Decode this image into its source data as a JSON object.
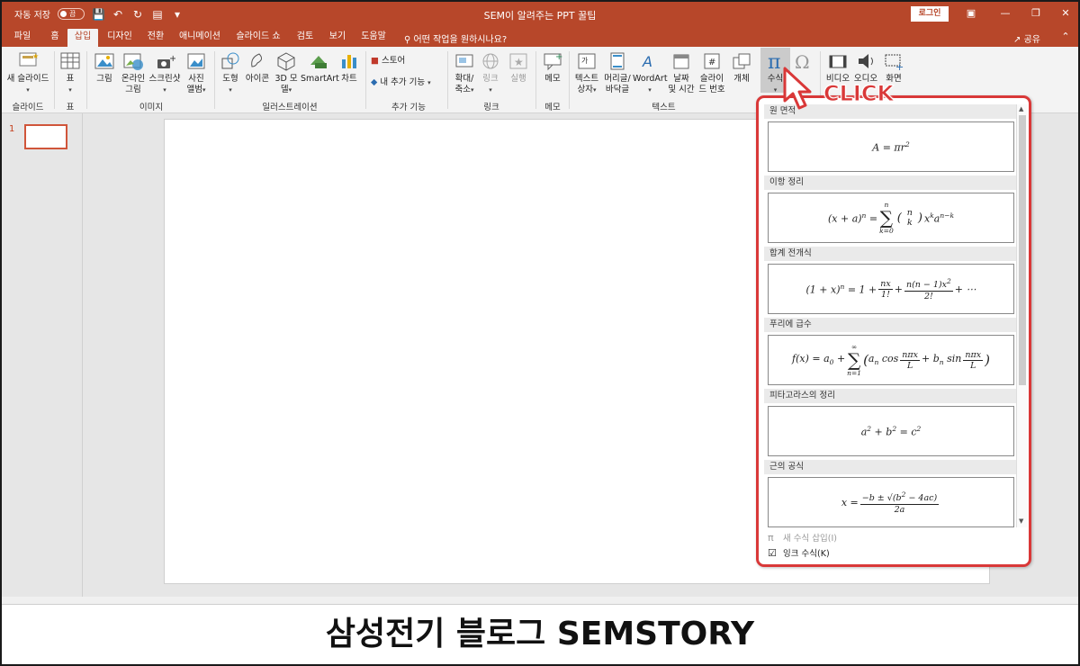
{
  "titlebar": {
    "autosave_label": "자동 저장",
    "autosave_state": "끔",
    "title": "SEM이 알려주는 PPT 꿀팁",
    "login": "로그인"
  },
  "tabs": [
    {
      "label": "파일",
      "active": false
    },
    {
      "label": "홈",
      "active": false
    },
    {
      "label": "삽입",
      "active": true
    },
    {
      "label": "디자인",
      "active": false
    },
    {
      "label": "전환",
      "active": false
    },
    {
      "label": "애니메이션",
      "active": false
    },
    {
      "label": "슬라이드 쇼",
      "active": false
    },
    {
      "label": "검토",
      "active": false
    },
    {
      "label": "보기",
      "active": false
    },
    {
      "label": "도움말",
      "active": false
    }
  ],
  "tell_me": "어떤 작업을 원하시나요?",
  "share": "공유",
  "ribbon": {
    "new_slide": "새 슬라이드",
    "table": "표",
    "picture": "그림",
    "online_picture_1": "온라인",
    "online_picture_2": "그림",
    "screenshot": "스크린샷",
    "album_1": "사진",
    "album_2": "앨범",
    "shapes": "도형",
    "icons": "아이콘",
    "model3d_1": "3D 모",
    "model3d_2": "델",
    "smartart": "SmartArt",
    "chart": "차트",
    "store": "스토어",
    "my_addins": "내 추가 기능",
    "zoom_1": "확대/",
    "zoom_2": "축소",
    "link": "링크",
    "action": "실행",
    "comment": "메모",
    "textbox_1": "텍스트",
    "textbox_2": "상자",
    "header_1": "머리글/",
    "header_2": "바닥글",
    "wordart": "WordArt",
    "datetime_1": "날짜",
    "datetime_2": "및 시간",
    "slidenum_1": "슬라이",
    "slidenum_2": "드 번호",
    "object": "개체",
    "equation": "수식",
    "video": "비디오",
    "audio": "오디오",
    "screen_rec": "화면",
    "groups": {
      "slides": "슬라이드",
      "tables": "표",
      "images": "이미지",
      "illustrations": "일러스트레이션",
      "addins": "추가 기능",
      "links": "링크",
      "comments": "메모",
      "text": "텍스트"
    }
  },
  "thumbnail_number": "1",
  "equation_gallery": {
    "items": [
      {
        "category": "원 면적"
      },
      {
        "category": "이항 정리"
      },
      {
        "category": "합계 전개식"
      },
      {
        "category": "푸리에 급수"
      },
      {
        "category": "피타고라스의 정리"
      },
      {
        "category": "근의 공식"
      }
    ],
    "insert_new": "새 수식 삽입(I)",
    "ink_equation": "잉크 수식(K)"
  },
  "annotation": "CLICK",
  "caption": "삼성전기 블로그 SEMSTORY",
  "colors": {
    "accent": "#b7472a",
    "highlight_red": "#d93838"
  }
}
